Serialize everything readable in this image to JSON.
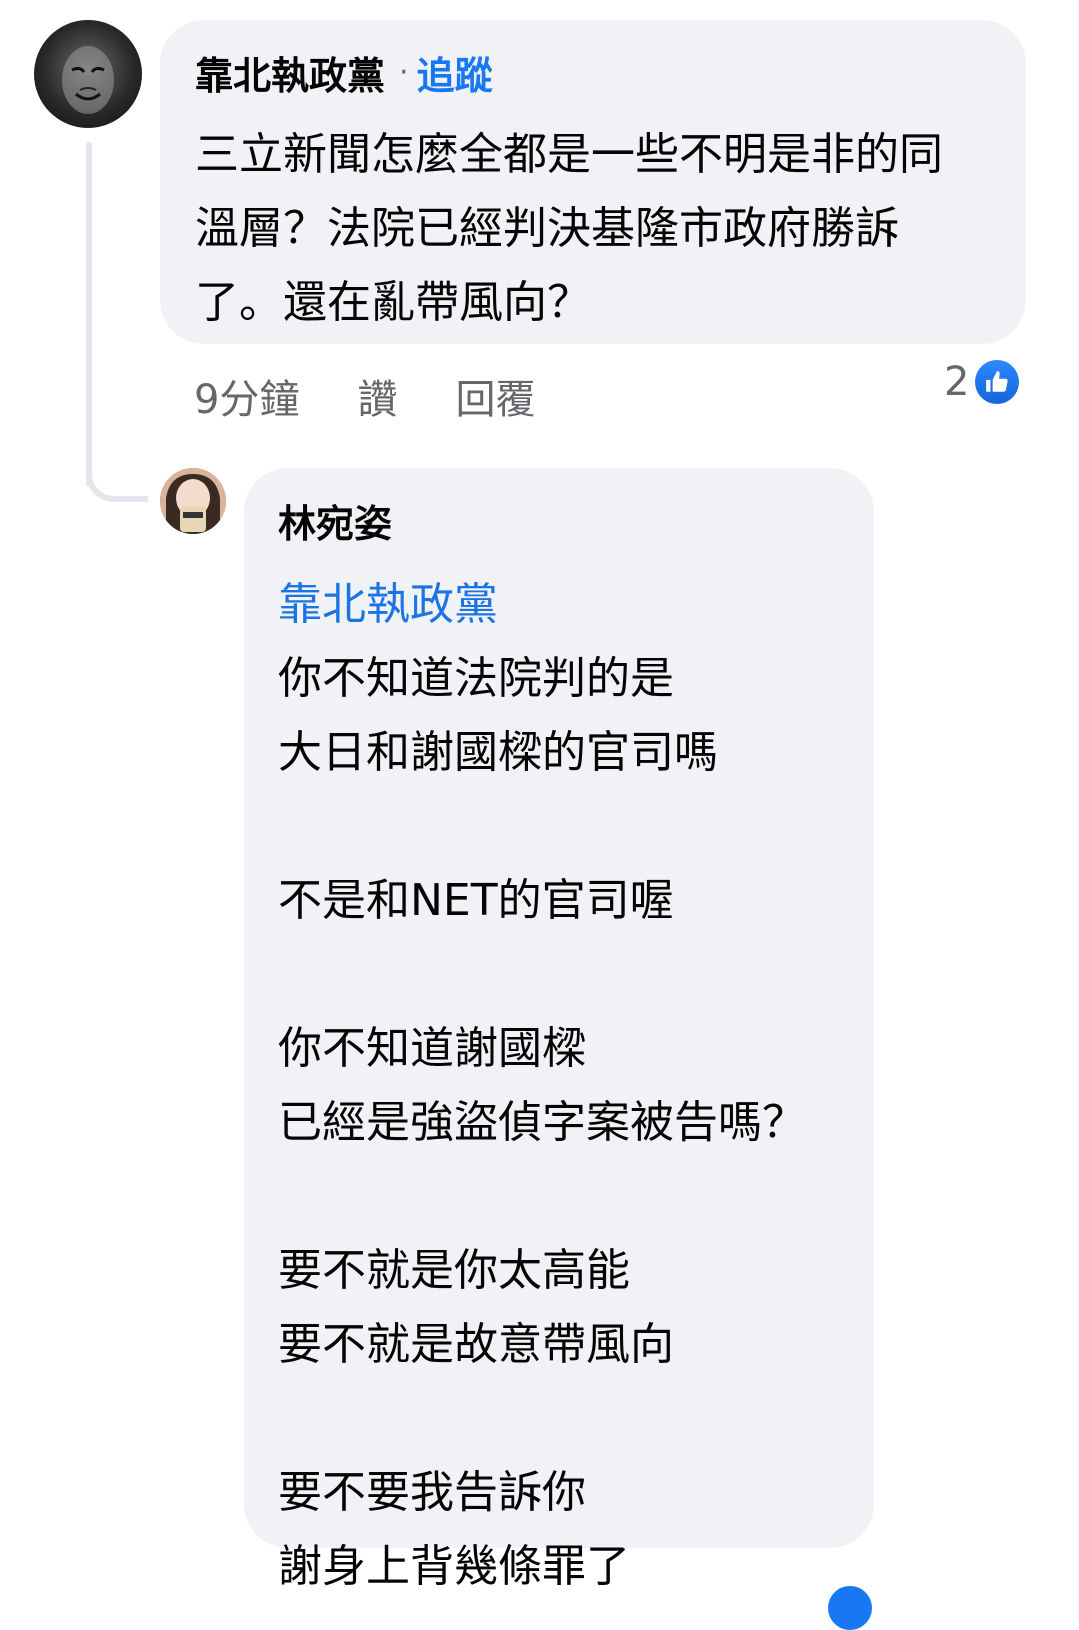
{
  "comment": {
    "author": "靠北執政黨",
    "separator": "·",
    "follow_label": "追蹤",
    "text": "三立新聞怎麼全都是一些不明是非的同\n溫層？法院已經判決基隆市政府勝訴\n了。還在亂帶風向？",
    "timestamp": "9分鐘",
    "like_label": "讚",
    "reply_label": "回覆",
    "reaction_count": "2",
    "reaction_icon": "thumbs-up-icon"
  },
  "reply": {
    "author": "林宛姿",
    "mention": "靠北執政黨",
    "text": "你不知道法院判的是\n大日和謝國樑的官司嗎\n\n不是和NET的官司喔\n\n你不知道謝國樑\n已經是強盜偵字案被告嗎？\n\n要不就是你太高能\n要不就是故意帶風向\n\n要不要我告訴你\n謝身上背幾條罪了"
  },
  "colors": {
    "bubble_bg": "#f0f2f5",
    "link_blue": "#1877f2",
    "meta_gray": "#65676b",
    "text": "#050505"
  }
}
